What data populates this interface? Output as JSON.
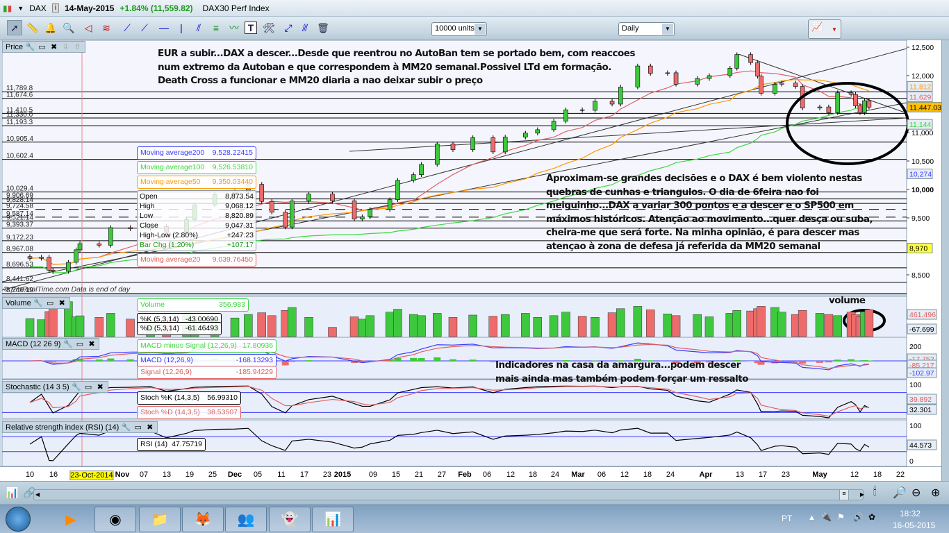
{
  "titlebar": {
    "symbol": "DAX",
    "date": "14-May-2015",
    "change": "+1.84% (11,559.82)",
    "name": "DAX30 Perf Index",
    "change_color": "#1a9a1a"
  },
  "toolbar": {
    "icons": [
      "pointer-icon",
      "ruler-icon",
      "alarm-bell-icon",
      "magnifier-icon",
      "triangle-tool-icon",
      "channel-tool-icon",
      "line-segment-icon",
      "ray-icon",
      "horizontal-line-icon",
      "vertical-line-icon",
      "parallel-lines-icon",
      "fibonacci-icon",
      "trend-channel-icon",
      "text-tool-icon",
      "tools-icon",
      "extend-line-icon",
      "parallel-ray-icon",
      "trash-icon"
    ],
    "units": "10000 units",
    "period": "Daily"
  },
  "panels": {
    "price": "Price",
    "volume": "Volume",
    "macd": "MACD (12 26 9)",
    "stochastic": "Stochastic (14 3 5)",
    "rsi": "Relative strength index (RSI) (14)"
  },
  "annotations": {
    "top": "EUR a subir...DAX a descer...Desde que reentrou no AutoBan tem se portado bem, com reaccoes num extremo da Autoban e que correspondem à MM20 semanal.Possivel LTd em formação. Death Cross a funcionar e MM20 diaria a nao deixar subir o preço",
    "middle": "Aproximam-se grandes decisões e o DAX é bem violento nestas quebras de cunhas e triangulos. O dia de 6feira nao foi meiguinho...DAX a variar 300 pontos e a descer e o SP500 em máximos históricos. Atenção ao movimento...quer desça ou suba, cheira-me que será forte. Na minha opinião, é para descer mas atençao à zona de defesa já referida da MM20 semanal",
    "indicators": "Indicadores na casa da amargura...podem descer mais ainda mas também podem forçar um ressalto",
    "volume": "volume"
  },
  "watermark": "© ProRealTime.com  Data is end of day",
  "level_labels": [
    "11,789.8",
    "11,674.6",
    "11,410.5",
    "11,330.0",
    "11,193.3",
    "10,905.4",
    "10,602.4",
    "10,029.4",
    "9,906.69",
    "9,828.14",
    "9,724.58",
    "9,587.14",
    "9,521.14",
    "9,393.37",
    "9,172.23",
    "8,967.08",
    "8,696.53",
    "8,441.62",
    "8,246.19"
  ],
  "levels": [
    11789.8,
    11674.6,
    11410.5,
    11330.0,
    11193.3,
    10905.4,
    10602.4,
    10029.4,
    9906.69,
    9828.14,
    9724.58,
    9587.14,
    9521.14,
    9393.37,
    9172.23,
    8967.08,
    8696.53,
    8441.62,
    8246.19
  ],
  "dashed_levels": [
    9724.58,
    9587.14
  ],
  "legend": {
    "ma200": {
      "label": "Moving average200",
      "value": "9,528.22415",
      "color": "#3a3aff"
    },
    "ma100": {
      "label": "Moving average100",
      "value": "9,526.53810",
      "color": "#3ad83a"
    },
    "ma50": {
      "label": "Moving average50",
      "value": "9,350.03440",
      "color": "#ff9a00"
    },
    "ma20": {
      "label": "Moving average20",
      "value": "9,039.76450",
      "color": "#e06060"
    },
    "ohlc": [
      [
        "Open",
        "8,873.54"
      ],
      [
        "High",
        "9,068.12"
      ],
      [
        "Low",
        "8,820.89"
      ],
      [
        "Close",
        "9,047.31"
      ],
      [
        "High-Low (2.80%)",
        "+247.23"
      ],
      [
        "Bar Chg (1.20%)",
        "+107.17"
      ]
    ],
    "volume": {
      "label": "Volume",
      "value": "356,983"
    },
    "k": {
      "label": "%K (5,3,14)",
      "value": "-43.00690"
    },
    "d": {
      "label": "%D (5,3,14)",
      "value": "-61.46493"
    },
    "macd_hist": {
      "label": "MACD minus Signal (12,26,9)",
      "value": "17.80936"
    },
    "macd": {
      "label": "MACD (12,26,9)",
      "value": "-168.13293"
    },
    "signal": {
      "label": "Signal (12,26,9)",
      "value": "-185.94229"
    },
    "stoch_k": {
      "label": "Stoch %K (14,3,5)",
      "value": "56.99310"
    },
    "stoch_d": {
      "label": "Stoch %D (14,3,5)",
      "value": "38.53507"
    },
    "rsi": {
      "label": "RSI (14)",
      "value": "47.75719"
    }
  },
  "price_axis": {
    "ticks": [
      "12,500",
      "12,000",
      "11,500",
      "11,000",
      "10,500",
      "10,000",
      "9,500",
      "9,000",
      "8,500"
    ],
    "tick_values": [
      12500,
      12000,
      11500,
      11000,
      10500,
      10000,
      9500,
      9000,
      8500
    ],
    "tags": [
      {
        "text": "11,812",
        "color": "#ff9a00"
      },
      {
        "text": "11,629",
        "color": "#e06060"
      },
      {
        "text": "11,447.03",
        "color": "#000"
      },
      {
        "text": "11,144",
        "color": "#3ad83a"
      },
      {
        "text": "10,274",
        "color": "#3a3aff"
      },
      {
        "text": "8,970",
        "color": "#000"
      }
    ],
    "tag_values": [
      11812,
      11629,
      11447.03,
      11144,
      10274,
      8970
    ]
  },
  "sub_axis": {
    "volume_tags": [
      "461,496",
      "-67.699"
    ],
    "macd_ticks": [
      "200"
    ],
    "macd_tags": [
      "-17.752",
      "-85.217",
      "-102.97"
    ],
    "stoch_ticks": [
      "100",
      "0"
    ],
    "stoch_tags": [
      "39.892",
      "32.301"
    ],
    "rsi_ticks": [
      "100",
      "0"
    ],
    "rsi_tag": "44.573"
  },
  "date_axis": {
    "labels": [
      "10",
      "16",
      "23-Oct-2014",
      "Nov",
      "07",
      "13",
      "19",
      "25",
      "Dec",
      "05",
      "11",
      "17",
      "23",
      "2015",
      "09",
      "15",
      "21",
      "27",
      "Feb",
      "06",
      "12",
      "18",
      "24",
      "Mar",
      "06",
      "12",
      "18",
      "24",
      "Apr",
      "13",
      "17",
      "23",
      "May",
      "12",
      "18",
      "22"
    ],
    "bold": [
      "Nov",
      "Dec",
      "2015",
      "Feb",
      "Mar",
      "Apr",
      "May"
    ],
    "highlight": "23-Oct-2014"
  },
  "chart_data": {
    "type": "candlestick",
    "series": [
      {
        "date": "2014-10-10",
        "close": 8790
      },
      {
        "date": "2014-10-13",
        "close": 8810
      },
      {
        "date": "2014-10-15",
        "close": 8580
      },
      {
        "date": "2014-10-16",
        "close": 8560
      },
      {
        "date": "2014-10-20",
        "close": 8720
      },
      {
        "date": "2014-10-22",
        "close": 8940
      },
      {
        "date": "2014-10-23",
        "close": 9047
      },
      {
        "date": "2014-10-28",
        "close": 9020
      },
      {
        "date": "2014-10-31",
        "close": 9330
      },
      {
        "date": "2014-11-05",
        "close": 9310
      },
      {
        "date": "2014-11-10",
        "close": 9350
      },
      {
        "date": "2014-11-14",
        "close": 9250
      },
      {
        "date": "2014-11-19",
        "close": 9470
      },
      {
        "date": "2014-11-21",
        "close": 9730
      },
      {
        "date": "2014-11-26",
        "close": 9910
      },
      {
        "date": "2014-12-01",
        "close": 9960
      },
      {
        "date": "2014-12-05",
        "close": 10090
      },
      {
        "date": "2014-12-09",
        "close": 9790
      },
      {
        "date": "2014-12-12",
        "close": 9600
      },
      {
        "date": "2014-12-16",
        "close": 9340
      },
      {
        "date": "2014-12-18",
        "close": 9800
      },
      {
        "date": "2014-12-23",
        "close": 9920
      },
      {
        "date": "2014-12-30",
        "close": 9800
      },
      {
        "date": "2015-01-05",
        "close": 9480
      },
      {
        "date": "2015-01-07",
        "close": 9520
      },
      {
        "date": "2015-01-09",
        "close": 9650
      },
      {
        "date": "2015-01-14",
        "close": 9820
      },
      {
        "date": "2015-01-16",
        "close": 10160
      },
      {
        "date": "2015-01-20",
        "close": 10260
      },
      {
        "date": "2015-01-22",
        "close": 10440
      },
      {
        "date": "2015-01-26",
        "close": 10800
      },
      {
        "date": "2015-01-30",
        "close": 10700
      },
      {
        "date": "2015-02-04",
        "close": 10910
      },
      {
        "date": "2015-02-09",
        "close": 10660
      },
      {
        "date": "2015-02-12",
        "close": 10920
      },
      {
        "date": "2015-02-17",
        "close": 10990
      },
      {
        "date": "2015-02-20",
        "close": 11050
      },
      {
        "date": "2015-02-24",
        "close": 11200
      },
      {
        "date": "2015-02-27",
        "close": 11400
      },
      {
        "date": "2015-03-03",
        "close": 11390
      },
      {
        "date": "2015-03-06",
        "close": 11550
      },
      {
        "date": "2015-03-10",
        "close": 11500
      },
      {
        "date": "2015-03-12",
        "close": 11800
      },
      {
        "date": "2015-03-16",
        "close": 12170
      },
      {
        "date": "2015-03-19",
        "close": 12040
      },
      {
        "date": "2015-03-23",
        "close": 12050
      },
      {
        "date": "2015-03-25",
        "close": 11850
      },
      {
        "date": "2015-03-30",
        "close": 11950
      },
      {
        "date": "2015-04-02",
        "close": 12000
      },
      {
        "date": "2015-04-08",
        "close": 12130
      },
      {
        "date": "2015-04-10",
        "close": 12370
      },
      {
        "date": "2015-04-14",
        "close": 12230
      },
      {
        "date": "2015-04-16",
        "close": 11990
      },
      {
        "date": "2015-04-17",
        "close": 11690
      },
      {
        "date": "2015-04-21",
        "close": 11850
      },
      {
        "date": "2015-04-23",
        "close": 11870
      },
      {
        "date": "2015-04-27",
        "close": 11810
      },
      {
        "date": "2015-04-29",
        "close": 11430
      },
      {
        "date": "2015-05-04",
        "close": 11450
      },
      {
        "date": "2015-05-06",
        "close": 11350
      },
      {
        "date": "2015-05-08",
        "close": 11700
      },
      {
        "date": "2015-05-11",
        "close": 11670
      },
      {
        "date": "2015-05-12",
        "close": 11470
      },
      {
        "date": "2015-05-13",
        "close": 11350
      },
      {
        "date": "2015-05-14",
        "close": 11560
      },
      {
        "date": "2015-05-15",
        "close": 11447
      }
    ],
    "volume": [
      310000,
      290000,
      430000,
      520000,
      600000,
      340000,
      356983,
      330000,
      400000,
      300000,
      280000,
      330000,
      390000,
      350000,
      300000,
      320000,
      380000,
      410000,
      360000,
      450000,
      500000,
      330000,
      160000,
      340000,
      300000,
      360000,
      420000,
      470000,
      380000,
      360000,
      400000,
      330000,
      370000,
      350000,
      380000,
      400000,
      330000,
      360000,
      420000,
      350000,
      330000,
      410000,
      480000,
      520000,
      460000,
      390000,
      360000,
      380000,
      340000,
      400000,
      450000,
      440000,
      480000,
      520000,
      500000,
      420000,
      380000,
      450000,
      400000,
      380000,
      360000,
      420000,
      380000,
      340000,
      420000,
      461496
    ]
  },
  "bottombar": {
    "icons": [
      "chart-settings-icon",
      "link-icon",
      "scroll-left-icon",
      "scroll-handle-icon",
      "scroll-right-icon",
      "candle-settings-icon",
      "zoom-fit-icon",
      "zoom-out-icon",
      "zoom-in-icon"
    ]
  },
  "taskbar": {
    "apps": [
      "media-player-icon",
      "chrome-icon",
      "explorer-icon",
      "firefox-icon",
      "messenger-icon",
      "ghost-app-icon",
      "prorealtime-icon"
    ],
    "lang": "PT",
    "time": "18:32",
    "date": "16-05-2015"
  }
}
